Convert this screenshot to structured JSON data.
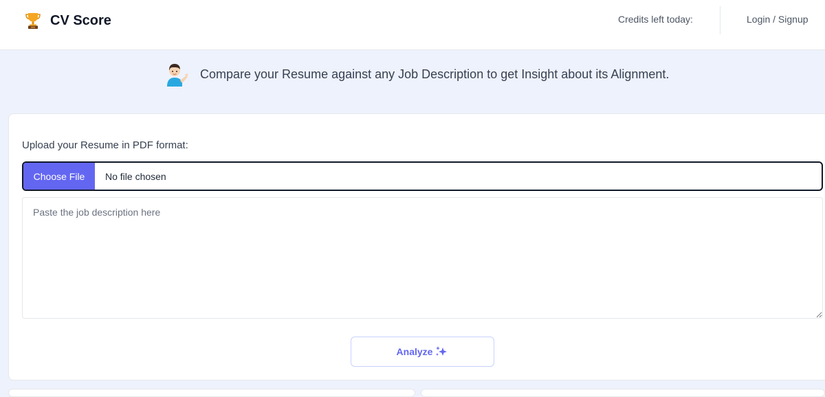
{
  "header": {
    "brand_icon": "trophy-icon",
    "brand_name": "CV Score",
    "credits_label": "Credits left today:",
    "login_label": "Login / Signup"
  },
  "hero": {
    "icon": "person-tipping-hand-icon",
    "tagline": "Compare your Resume against any Job Description to get Insight about its Alignment."
  },
  "form": {
    "upload_label": "Upload your Resume in PDF format:",
    "choose_file_label": "Choose File",
    "file_status": "No file chosen",
    "job_description_placeholder": "Paste the job description here",
    "job_description_value": "",
    "analyze_label": "Analyze",
    "analyze_icon": "sparkles-icon"
  },
  "colors": {
    "accent": "#6366f1",
    "background": "#eef2fc",
    "card": "#ffffff"
  }
}
